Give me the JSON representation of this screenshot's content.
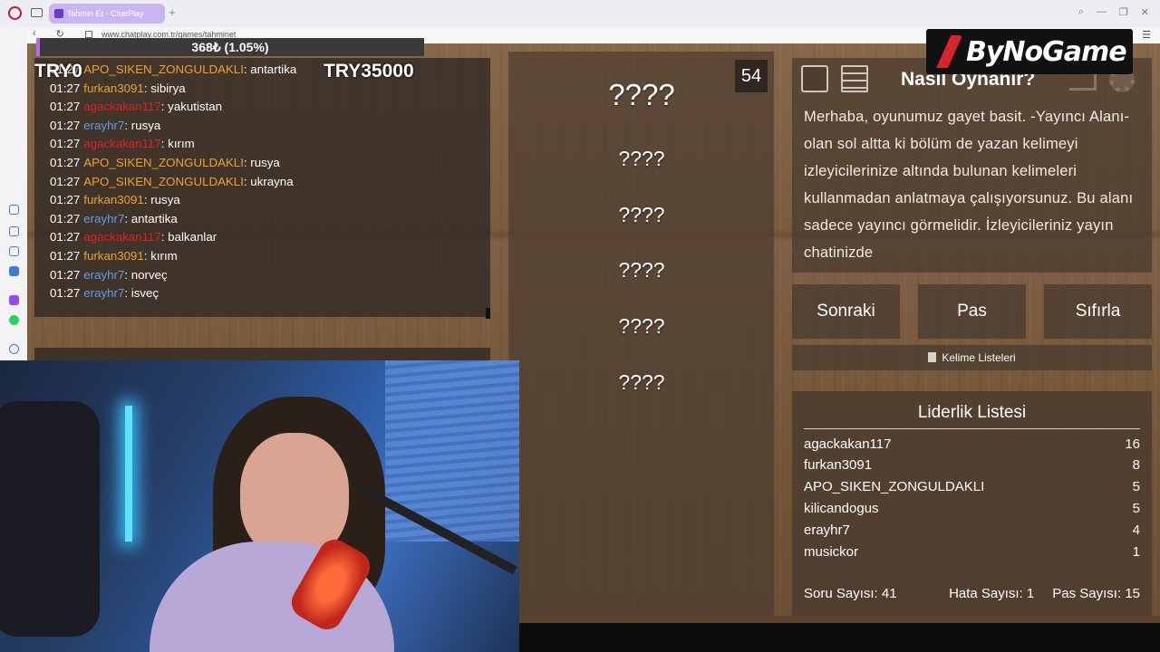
{
  "browser": {
    "tab_title": "Tahmin Et - ChatPlay",
    "new_tab": "+",
    "url": "www.chatplay.com.tr/games/tahminet"
  },
  "overlay": {
    "progress_text": "368₺ (1.05%)",
    "progress_fraction": 0.0105,
    "goal_left": "TRY0",
    "goal_right": "TRY35000",
    "logo_text": "ByNoGame"
  },
  "chat": [
    {
      "time": "01:27",
      "user": "APO_SIKEN_ZONGULDAKLI",
      "color": "#f0a030",
      "text": ": antartika"
    },
    {
      "time": "01:27",
      "user": "furkan3091",
      "color": "#e8a52b",
      "text": ": sibirya"
    },
    {
      "time": "01:27",
      "user": "agackakan117",
      "color": "#e0202a",
      "text": ": yakutistan"
    },
    {
      "time": "01:27",
      "user": "erayhr7",
      "color": "#5c9fe8",
      "text": ": rusya"
    },
    {
      "time": "01:27",
      "user": "agackakan117",
      "color": "#e0202a",
      "text": ": kırım"
    },
    {
      "time": "01:27",
      "user": "APO_SIKEN_ZONGULDAKLI",
      "color": "#f0a030",
      "text": ": rusya"
    },
    {
      "time": "01:27",
      "user": "APO_SIKEN_ZONGULDAKLI",
      "color": "#f0a030",
      "text": ": ukrayna"
    },
    {
      "time": "01:27",
      "user": "furkan3091",
      "color": "#e8a52b",
      "text": ": rusya"
    },
    {
      "time": "01:27",
      "user": "erayhr7",
      "color": "#5c9fe8",
      "text": ": antartika"
    },
    {
      "time": "01:27",
      "user": "agackakan117",
      "color": "#e0202a",
      "text": ": balkanlar"
    },
    {
      "time": "01:27",
      "user": "furkan3091",
      "color": "#e8a52b",
      "text": ": kırım"
    },
    {
      "time": "01:27",
      "user": "erayhr7",
      "color": "#5c9fe8",
      "text": ": norveç"
    },
    {
      "time": "01:27",
      "user": "erayhr7",
      "color": "#5c9fe8",
      "text": ": isveç"
    }
  ],
  "game": {
    "timer": "54",
    "words": [
      "????",
      "????",
      "????",
      "????",
      "????",
      "????"
    ]
  },
  "how_to": {
    "title": "Nasıl Oynanır?",
    "text": "Merhaba, oyunumuz gayet basit. -Yayıncı Alanı- olan sol altta ki bölüm de yazan kelimeyi izleyicilerinize altında bulunan kelimeleri kullanmadan anlatmaya çalışıyorsunuz. Bu alanı sadece yayıncı görmelidir. İzleyicileriniz yayın chatinizde"
  },
  "buttons": {
    "next": "Sonraki",
    "pass": "Pas",
    "reset": "Sıfırla",
    "word_lists": "Kelime Listeleri"
  },
  "leaderboard": {
    "title": "Liderlik Listesi",
    "rows": [
      {
        "name": "agackakan117",
        "score": "16"
      },
      {
        "name": "furkan3091",
        "score": "8"
      },
      {
        "name": "APO_SIKEN_ZONGULDAKLI",
        "score": "5"
      },
      {
        "name": "kilicandogus",
        "score": "5"
      },
      {
        "name": "erayhr7",
        "score": "4"
      },
      {
        "name": "musickor",
        "score": "1"
      }
    ],
    "question_count": "Soru Sayısı: 41",
    "error_count": "Hata Sayısı: 1",
    "pass_count": "Pas Sayısı: 15"
  }
}
